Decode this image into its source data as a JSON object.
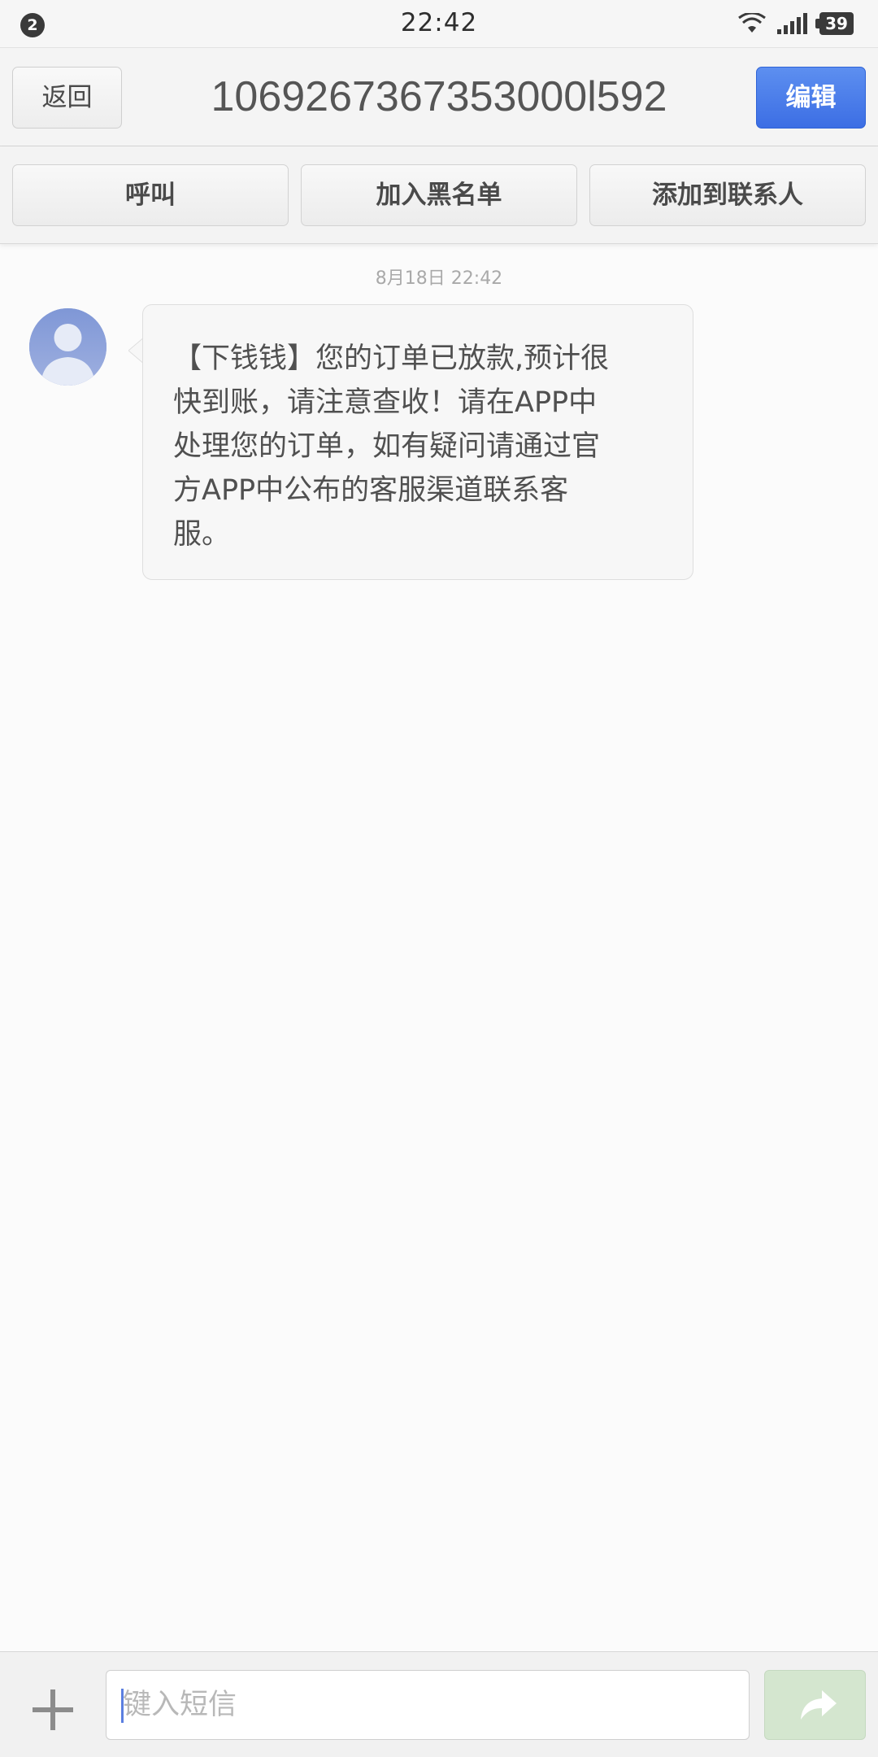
{
  "status_bar": {
    "notification_count": "2",
    "time": "22:42",
    "battery": "39",
    "icons": [
      "wifi-icon",
      "signal-icon",
      "battery-icon"
    ]
  },
  "header": {
    "back_label": "返回",
    "title": "1069267367353000l592",
    "edit_label": "编辑"
  },
  "actions": {
    "call_label": "呼叫",
    "blacklist_label": "加入黑名单",
    "add_contact_label": "添加到联系人"
  },
  "conversation": {
    "date": "8月18日 22:42",
    "messages": [
      {
        "lines": [
          "【下钱钱】您的订单已放款,预计很",
          "快到账，请注意查收！请在APP中",
          "处理您的订单，如有疑问请通过官",
          "方APP中公布的客服渠道联系客",
          "服。"
        ]
      }
    ]
  },
  "composer": {
    "placeholder": "键入短信",
    "icons": [
      "plus-icon",
      "send-icon"
    ]
  },
  "colors": {
    "accent": "#3c6ee4",
    "send_disabled": "#d4e6cf",
    "background": "#fbfbfb"
  }
}
